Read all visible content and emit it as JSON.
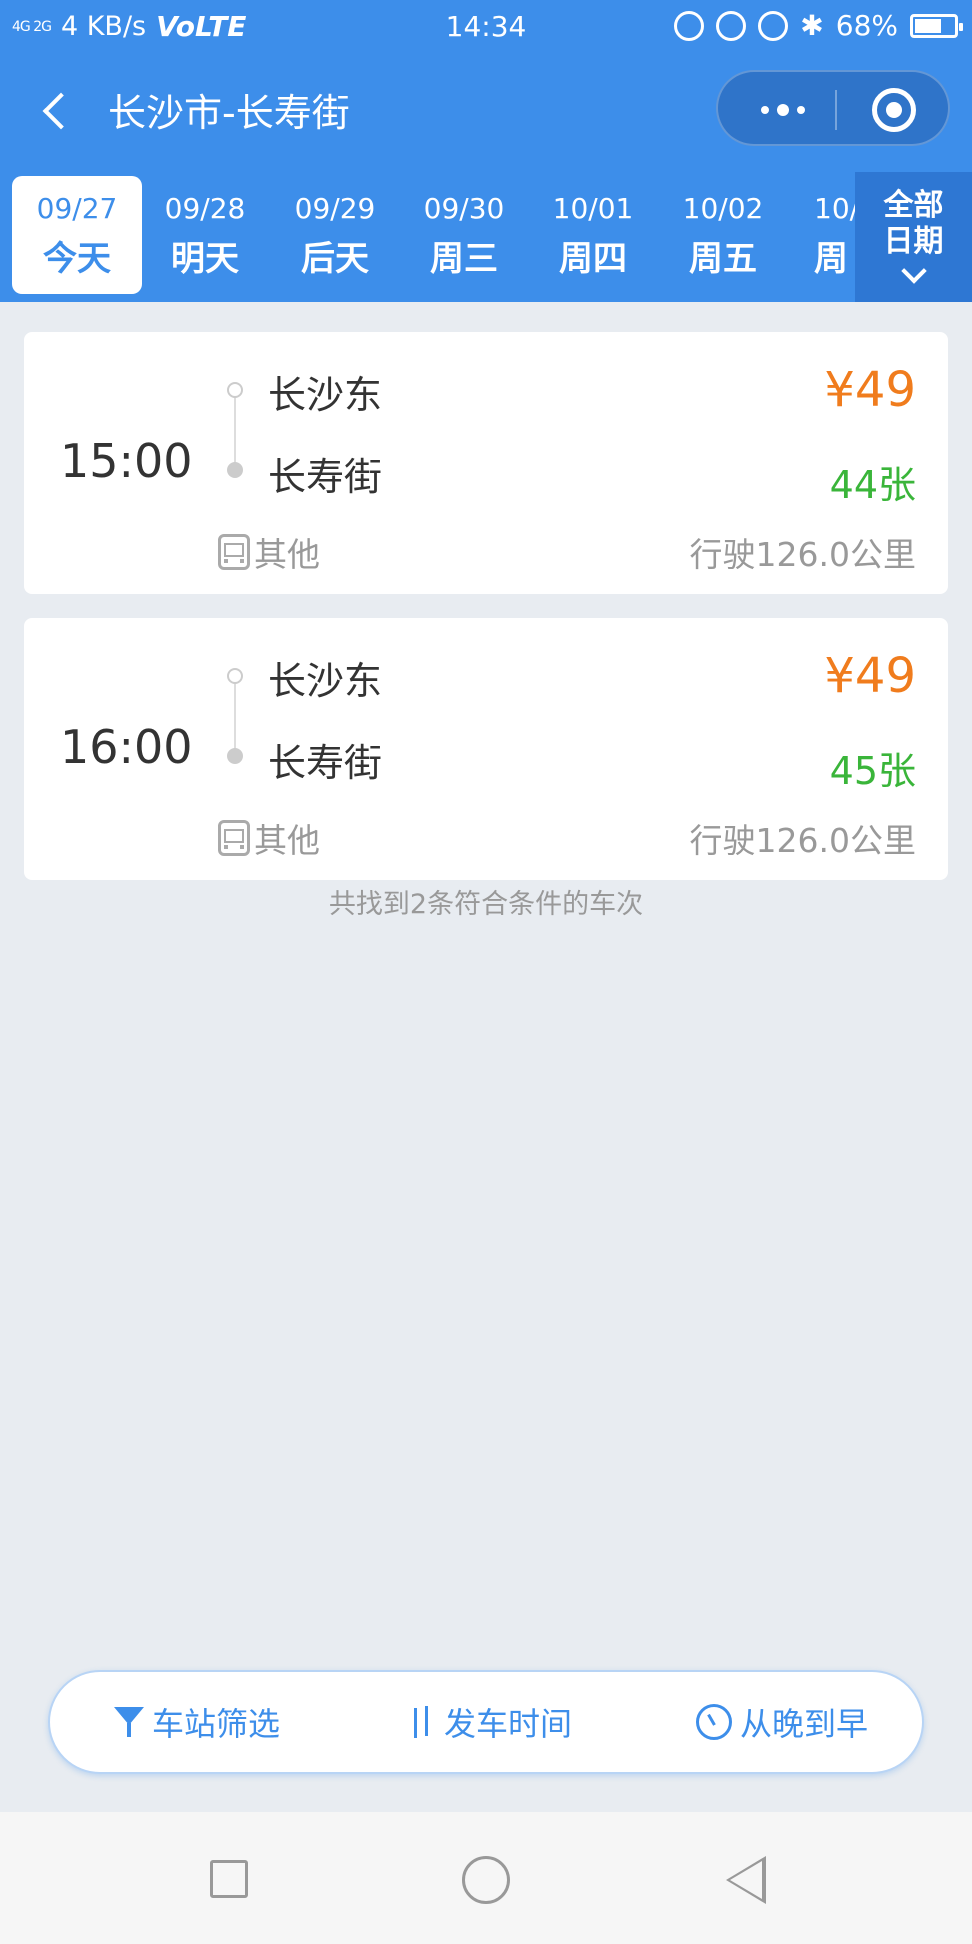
{
  "status_bar": {
    "network": "4G 2G",
    "speed": "4 KB/s",
    "volte": "VoLTE",
    "time": "14:34",
    "battery": "68%",
    "icons": [
      "headphones-icon",
      "lock-rotation-icon",
      "alarm-icon",
      "bluetooth-icon",
      "battery-icon"
    ]
  },
  "header": {
    "title": "长沙市-长寿街"
  },
  "dates": [
    {
      "date": "09/27",
      "weekday": "今天",
      "selected": true
    },
    {
      "date": "09/28",
      "weekday": "明天"
    },
    {
      "date": "09/29",
      "weekday": "后天"
    },
    {
      "date": "09/30",
      "weekday": "周三"
    },
    {
      "date": "10/01",
      "weekday": "周四"
    },
    {
      "date": "10/02",
      "weekday": "周五"
    },
    {
      "date": "10/",
      "weekday": "周"
    }
  ],
  "all_dates": {
    "line1": "全部",
    "line2": "日期"
  },
  "trips": [
    {
      "time": "15:00",
      "from": "长沙东",
      "to": "长寿街",
      "price": "¥49",
      "tickets": "44张",
      "type": "其他",
      "distance": "行驶126.0公里"
    },
    {
      "time": "16:00",
      "from": "长沙东",
      "to": "长寿街",
      "price": "¥49",
      "tickets": "45张",
      "type": "其他",
      "distance": "行驶126.0公里"
    }
  ],
  "summary": "共找到2条符合条件的车次",
  "toolbar": {
    "filter_label": "车站筛选",
    "time_label": "发车时间",
    "order_label": "从晚到早"
  },
  "colors": {
    "primary": "#3d8eea",
    "price": "#f07c1d",
    "tickets": "#3ab53a"
  }
}
